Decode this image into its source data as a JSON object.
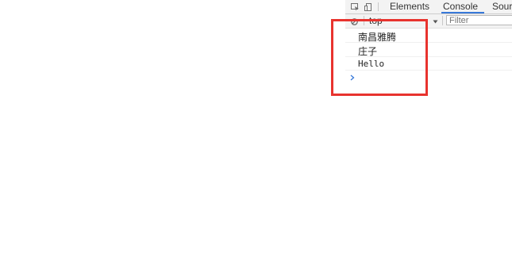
{
  "devtools": {
    "tabs": [
      {
        "label": "Elements",
        "active": false
      },
      {
        "label": "Console",
        "active": true
      },
      {
        "label": "Sour",
        "active": false
      }
    ],
    "toolbar": {
      "context": "top",
      "filter_placeholder": "Filter"
    },
    "console_lines": [
      {
        "text": "南昌雅腾"
      },
      {
        "text": "庄子"
      },
      {
        "text": "Hello"
      }
    ],
    "prompt_symbol": "›"
  },
  "colors": {
    "active_tab_underline": "#3879d9",
    "highlight_box": "#e8332e",
    "prompt": "#3879d9"
  },
  "icons": [
    "inspect-element-icon",
    "device-toolbar-icon",
    "clear-console-icon",
    "dropdown-arrow-icon",
    "console-prompt-icon"
  ]
}
